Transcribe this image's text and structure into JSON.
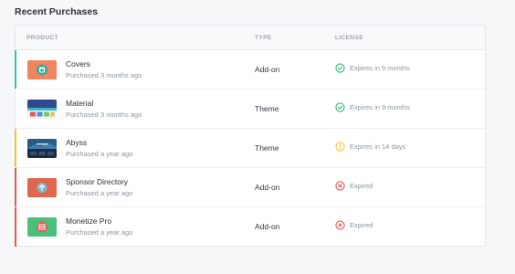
{
  "section_title": "Recent Purchases",
  "columns": {
    "product": "PRODUCT",
    "type": "TYPE",
    "license": "LICENSE"
  },
  "colors": {
    "green": "#3ab47a",
    "yellow": "#f2c334",
    "red": "#e25858",
    "teal_accent": "#3ec0a8"
  },
  "rows": [
    {
      "name": "Covers",
      "purchased": "Purchased 3 months ago",
      "type": "Add-on",
      "license": "Expires in 9 months",
      "status": "active",
      "thumb": "covers"
    },
    {
      "name": "Material",
      "purchased": "Purchased 3 months ago",
      "type": "Theme",
      "license": "Expires in 9 months",
      "status": "active",
      "thumb": "material"
    },
    {
      "name": "Abyss",
      "purchased": "Purchased a year ago",
      "type": "Theme",
      "license": "Expires in 14 days",
      "status": "expiring",
      "thumb": "abyss"
    },
    {
      "name": "Sponsor Directory",
      "purchased": "Purchased a year ago",
      "type": "Add-on",
      "license": "Expired",
      "status": "expired",
      "thumb": "sponsor"
    },
    {
      "name": "Monetize Pro",
      "purchased": "Purchased a year ago",
      "type": "Add-on",
      "license": "Expired",
      "status": "expired",
      "thumb": "monetize"
    }
  ]
}
